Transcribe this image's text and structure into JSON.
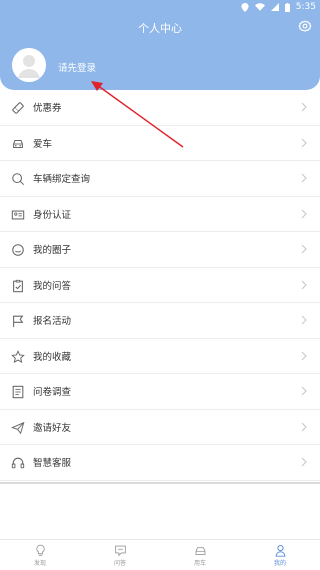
{
  "status_bar": {
    "time": "5:35",
    "icons": [
      "location-icon",
      "wifi-icon",
      "signal-icon",
      "battery-icon"
    ]
  },
  "header": {
    "title": "个人中心",
    "settings_icon": "gear-icon",
    "login_prompt": "请先登录",
    "background_color": "#8fb7ea"
  },
  "menu": {
    "items": [
      {
        "label": "优惠券",
        "icon": "ticket-icon"
      },
      {
        "label": "爱车",
        "icon": "car-icon"
      },
      {
        "label": "车辆绑定查询",
        "icon": "search-icon"
      },
      {
        "label": "身份认证",
        "icon": "id-card-icon"
      },
      {
        "label": "我的圈子",
        "icon": "circle-chat-icon"
      },
      {
        "label": "我的问答",
        "icon": "clipboard-check-icon"
      },
      {
        "label": "报名活动",
        "icon": "flag-icon"
      },
      {
        "label": "我的收藏",
        "icon": "star-icon"
      },
      {
        "label": "问卷调查",
        "icon": "document-icon"
      },
      {
        "label": "邀请好友",
        "icon": "send-icon"
      },
      {
        "label": "智慧客服",
        "icon": "headset-icon"
      }
    ]
  },
  "tabbar": {
    "active_color": "#5a8fd8",
    "inactive_color": "#9a9a9a",
    "items": [
      {
        "label": "发现",
        "icon": "bulb-icon",
        "active": false
      },
      {
        "label": "问答",
        "icon": "chat-icon",
        "active": false
      },
      {
        "label": "用车",
        "icon": "car-icon",
        "active": false
      },
      {
        "label": "我的",
        "icon": "person-icon",
        "active": true
      }
    ]
  },
  "annotation": {
    "arrow_color": "#e0202a"
  }
}
